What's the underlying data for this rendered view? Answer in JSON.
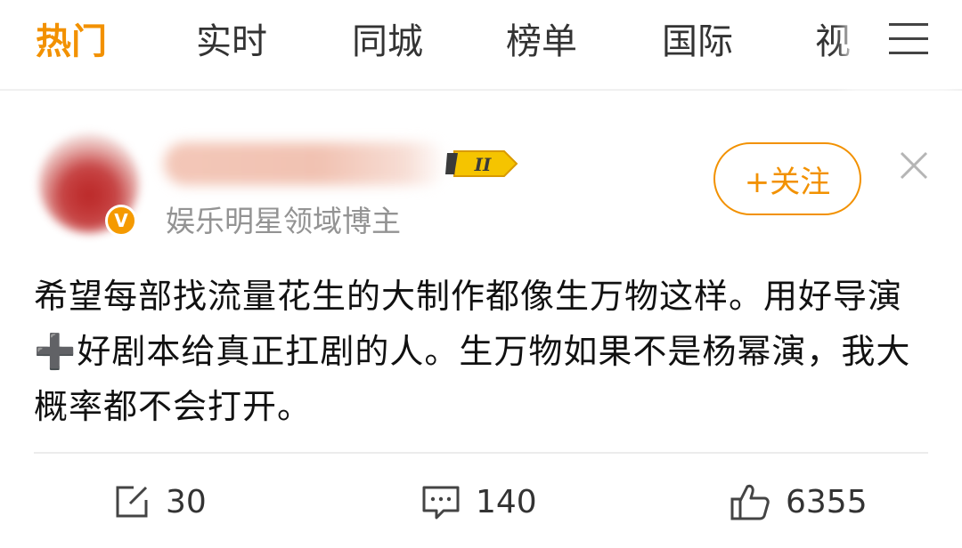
{
  "tabs": [
    {
      "label": "热门",
      "active": true
    },
    {
      "label": "实时",
      "active": false
    },
    {
      "label": "同城",
      "active": false
    },
    {
      "label": "榜单",
      "active": false
    },
    {
      "label": "国际",
      "active": false
    },
    {
      "label": "视",
      "active": false
    }
  ],
  "menu_icon": "hamburger-menu-icon",
  "post": {
    "username": "",
    "level_badge": "II",
    "verified_icon": "verified-v-icon",
    "subtitle": "娱乐明星领域博主",
    "follow_label": "+关注",
    "close_icon": "close-icon",
    "text": "希望每部找流量花生的大制作都像生万物这样。用好导演➕好剧本给真正扛剧的人。生万物如果不是杨幂演，我大概率都不会打开。",
    "actions": {
      "repost_count": "30",
      "comment_count": "140",
      "like_count": "6355"
    }
  },
  "colors": {
    "accent": "#f29100",
    "muted": "#939393",
    "divider": "#ececec"
  }
}
